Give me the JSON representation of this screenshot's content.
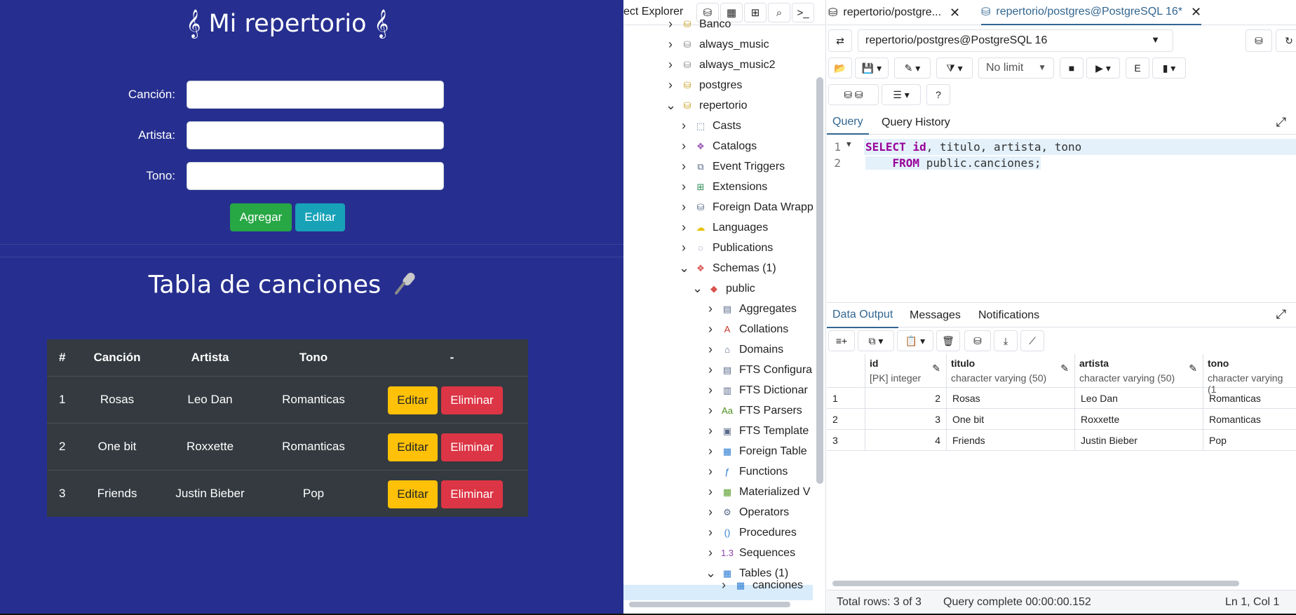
{
  "app": {
    "title": "𝄞 Mi repertorio 𝄞",
    "form": {
      "song_label": "Canción:",
      "artist_label": "Artista:",
      "tone_label": "Tono:",
      "song_value": "",
      "artist_value": "",
      "tone_value": ""
    },
    "add_button": "Agregar",
    "edit_button": "Editar",
    "table_title": "Tabla de canciones",
    "table": {
      "headers": [
        "#",
        "Canción",
        "Artista",
        "Tono",
        "-"
      ],
      "rows": [
        {
          "num": "1",
          "song": "Rosas",
          "artist": "Leo Dan",
          "tone": "Romanticas"
        },
        {
          "num": "2",
          "song": "One bit",
          "artist": "Roxxette",
          "tone": "Romanticas"
        },
        {
          "num": "3",
          "song": "Friends",
          "artist": "Justin Bieber",
          "tone": "Pop"
        }
      ],
      "edit_label": "Editar",
      "delete_label": "Eliminar"
    },
    "colors": {
      "bg": "#262f8f",
      "green": "#28a745",
      "teal": "#17a2b8",
      "yellow": "#ffc107",
      "red": "#dc3545",
      "table": "#343a40"
    }
  },
  "pgadmin": {
    "explorer_title": "ect Explorer",
    "tree": [
      {
        "label": "Banco",
        "icon": "database-icon"
      },
      {
        "label": "always_music",
        "icon": "database-disconnected-icon"
      },
      {
        "label": "always_music2",
        "icon": "database-disconnected-icon"
      },
      {
        "label": "postgres",
        "icon": "database-icon"
      },
      {
        "label": "repertorio",
        "icon": "database-icon"
      },
      {
        "label": "Casts",
        "icon": "casts-icon"
      },
      {
        "label": "Catalogs",
        "icon": "catalogs-icon"
      },
      {
        "label": "Event Triggers",
        "icon": "event-triggers-icon"
      },
      {
        "label": "Extensions",
        "icon": "extensions-icon"
      },
      {
        "label": "Foreign Data Wrapp",
        "icon": "foreign-data-wrapper-icon"
      },
      {
        "label": "Languages",
        "icon": "languages-icon"
      },
      {
        "label": "Publications",
        "icon": "publications-icon"
      },
      {
        "label": "Schemas (1)",
        "icon": "schemas-icon"
      },
      {
        "label": "public",
        "icon": "schema-icon"
      },
      {
        "label": "Aggregates",
        "icon": "aggregates-icon"
      },
      {
        "label": "Collations",
        "icon": "collations-icon"
      },
      {
        "label": "Domains",
        "icon": "domains-icon"
      },
      {
        "label": "FTS Configura",
        "icon": "fts-config-icon"
      },
      {
        "label": "FTS Dictionar",
        "icon": "fts-dictionary-icon"
      },
      {
        "label": "FTS Parsers",
        "icon": "fts-parsers-icon"
      },
      {
        "label": "FTS Template",
        "icon": "fts-template-icon"
      },
      {
        "label": "Foreign Table",
        "icon": "foreign-table-icon"
      },
      {
        "label": "Functions",
        "icon": "functions-icon"
      },
      {
        "label": "Materialized V",
        "icon": "materialized-view-icon"
      },
      {
        "label": "Operators",
        "icon": "operators-icon"
      },
      {
        "label": "Procedures",
        "icon": "procedures-icon"
      },
      {
        "label": "Sequences",
        "icon": "sequences-icon"
      },
      {
        "label": "Tables (1)",
        "icon": "tables-icon"
      },
      {
        "label": "canciones",
        "icon": "table-icon"
      }
    ],
    "tabs": [
      {
        "label": "repertorio/postgre...",
        "active": false
      },
      {
        "label": "repertorio/postgres@PostgreSQL 16*",
        "active": true
      }
    ],
    "connection": "repertorio/postgres@PostgreSQL 16",
    "limit": "No limit",
    "query_tabs": [
      "Query",
      "Query History"
    ],
    "sql_lines": [
      "1",
      "2"
    ],
    "output_tabs": [
      "Data Output",
      "Messages",
      "Notifications"
    ],
    "columns": [
      {
        "name": "id",
        "type": "[PK] integer"
      },
      {
        "name": "titulo",
        "type": "character varying (50)"
      },
      {
        "name": "artista",
        "type": "character varying (50)"
      },
      {
        "name": "tono",
        "type": "character varying (1"
      }
    ],
    "rows": [
      {
        "n": "1",
        "id": "2",
        "titulo": "Rosas",
        "artista": "Leo Dan",
        "tono": "Romanticas"
      },
      {
        "n": "2",
        "id": "3",
        "titulo": "One bit",
        "artista": "Roxxette",
        "tono": "Romanticas"
      },
      {
        "n": "3",
        "id": "4",
        "titulo": "Friends",
        "artista": "Justin Bieber",
        "tono": "Pop"
      }
    ],
    "status": {
      "rows": "Total rows: 3 of 3",
      "query": "Query complete 00:00:00.152",
      "pos": "Ln 1, Col 1"
    },
    "accent": "#326690"
  }
}
